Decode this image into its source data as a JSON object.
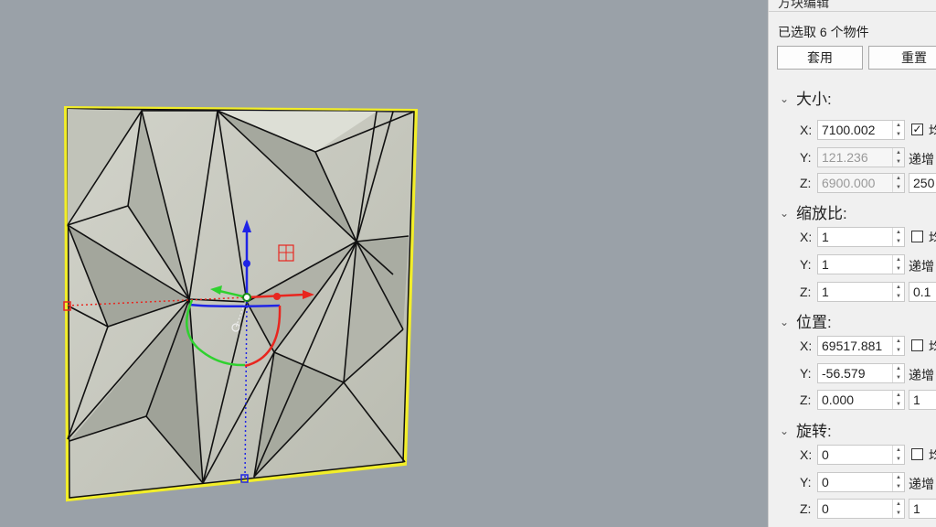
{
  "panel": {
    "title": "方块编辑",
    "selection_text": "已选取 6 个物件",
    "apply_label": "套用",
    "reset_label": "重置",
    "sections": {
      "size": {
        "title": "大小:",
        "x_label": "X:",
        "x_value": "7100.002",
        "y_label": "Y:",
        "y_value": "121.236",
        "z_label": "Z:",
        "z_value": "6900.000",
        "uniform_checked": true,
        "uniform_label": "均",
        "increment_label": "递增",
        "side_value": "250"
      },
      "scale": {
        "title": "缩放比:",
        "x_label": "X:",
        "x_value": "1",
        "y_label": "Y:",
        "y_value": "1",
        "z_label": "Z:",
        "z_value": "1",
        "uniform_checked": false,
        "uniform_label": "均",
        "increment_label": "递增",
        "side_value": "0.1"
      },
      "position": {
        "title": "位置:",
        "x_label": "X:",
        "x_value": "69517.881",
        "y_label": "Y:",
        "y_value": "-56.579",
        "z_label": "Z:",
        "z_value": "0.000",
        "uniform_checked": false,
        "uniform_label": "均",
        "increment_label": "递增",
        "side_value": "1"
      },
      "rotation": {
        "title": "旋转:",
        "x_label": "X:",
        "x_value": "0",
        "y_label": "Y:",
        "y_value": "0",
        "z_label": "Z:",
        "z_value": "0",
        "uniform_checked": false,
        "uniform_label": "均",
        "increment_label": "递增",
        "side_value": "1"
      }
    }
  },
  "colors": {
    "viewport_bg": "#9aa1a8",
    "panel_face": "#c8c9bf",
    "selection": "#f2ee2a",
    "gizmo_x": "#e8261f",
    "gizmo_y": "#2fd12f",
    "gizmo_z": "#1f24e6"
  }
}
